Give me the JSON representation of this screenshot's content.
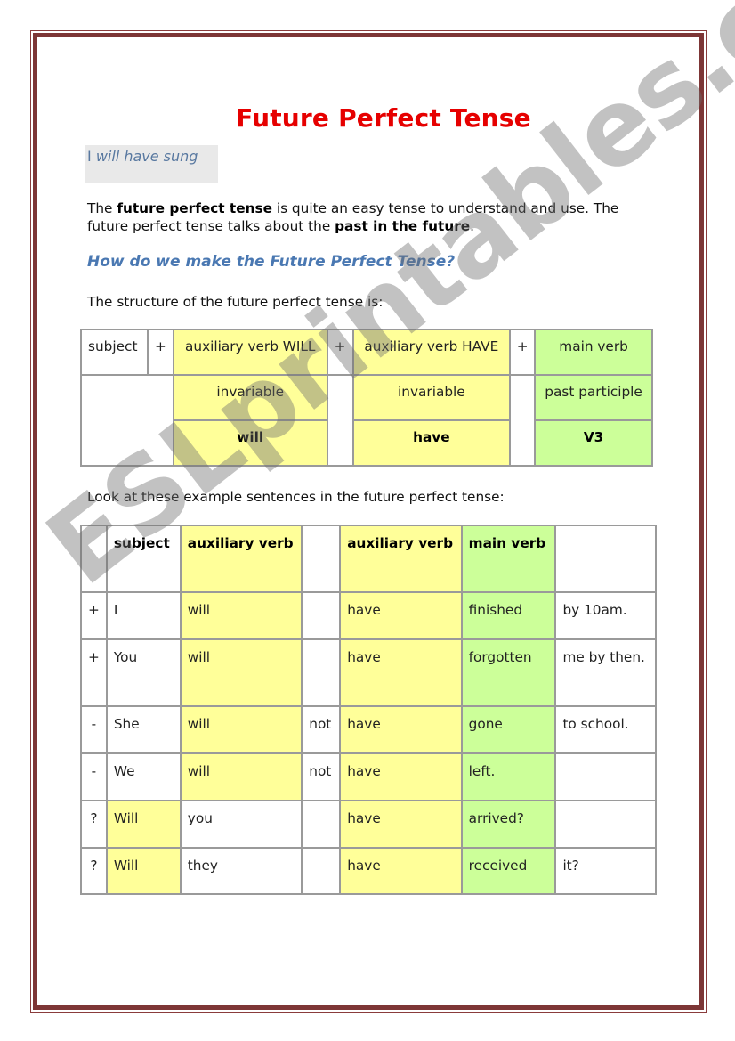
{
  "page": {
    "title": "Future Perfect Tense",
    "example_box": {
      "prefix": "I ",
      "text": "will have sung"
    },
    "intro": {
      "p1_a": "The ",
      "p1_bold": "future perfect tense",
      "p1_b": " is quite an easy tense to understand and use. The future perfect tense talks about the ",
      "p1_bold2": "past in the future",
      "p1_c": "."
    },
    "heading": "How do we make the Future Perfect Tense?",
    "structure_intro": "The structure of the future perfect tense is:",
    "structure_table": {
      "row1": [
        "subject",
        "+",
        "auxiliary verb WILL",
        "+",
        "auxiliary verb HAVE",
        "+",
        "main verb"
      ],
      "row2": {
        "will_col": "invariable",
        "have_col": "invariable",
        "main_col": "past participle"
      },
      "row3": {
        "will_col": "will",
        "have_col": "have",
        "main_col": "V3"
      }
    },
    "examples_intro": "Look at these example sentences in the future perfect tense:",
    "examples_table": {
      "header": [
        "",
        "subject",
        "auxiliary verb",
        "",
        "auxiliary verb",
        "main verb",
        ""
      ],
      "rows": [
        [
          "+",
          "I",
          "will",
          "",
          "have",
          "finished",
          "by 10am."
        ],
        [
          "+",
          "You",
          "will",
          "",
          "have",
          "forgotten",
          "me by then."
        ],
        [
          "-",
          "She",
          "will",
          "not",
          "have",
          "gone",
          "to school."
        ],
        [
          "-",
          "We",
          "will",
          "not",
          "have",
          "left.",
          ""
        ],
        [
          "?",
          "Will",
          "you",
          "",
          "have",
          "arrived?",
          ""
        ],
        [
          "?",
          "Will",
          "they",
          "",
          "have",
          "received",
          "it?"
        ]
      ]
    },
    "watermark": "ESLprintables.com"
  },
  "colors": {
    "title": "#e60000",
    "heading": "#4a78b2",
    "frame": "#7d3636",
    "yellow_cell": "#ffff99",
    "green_cell": "#ccff99",
    "example_box_bg": "#e9e9e9"
  }
}
